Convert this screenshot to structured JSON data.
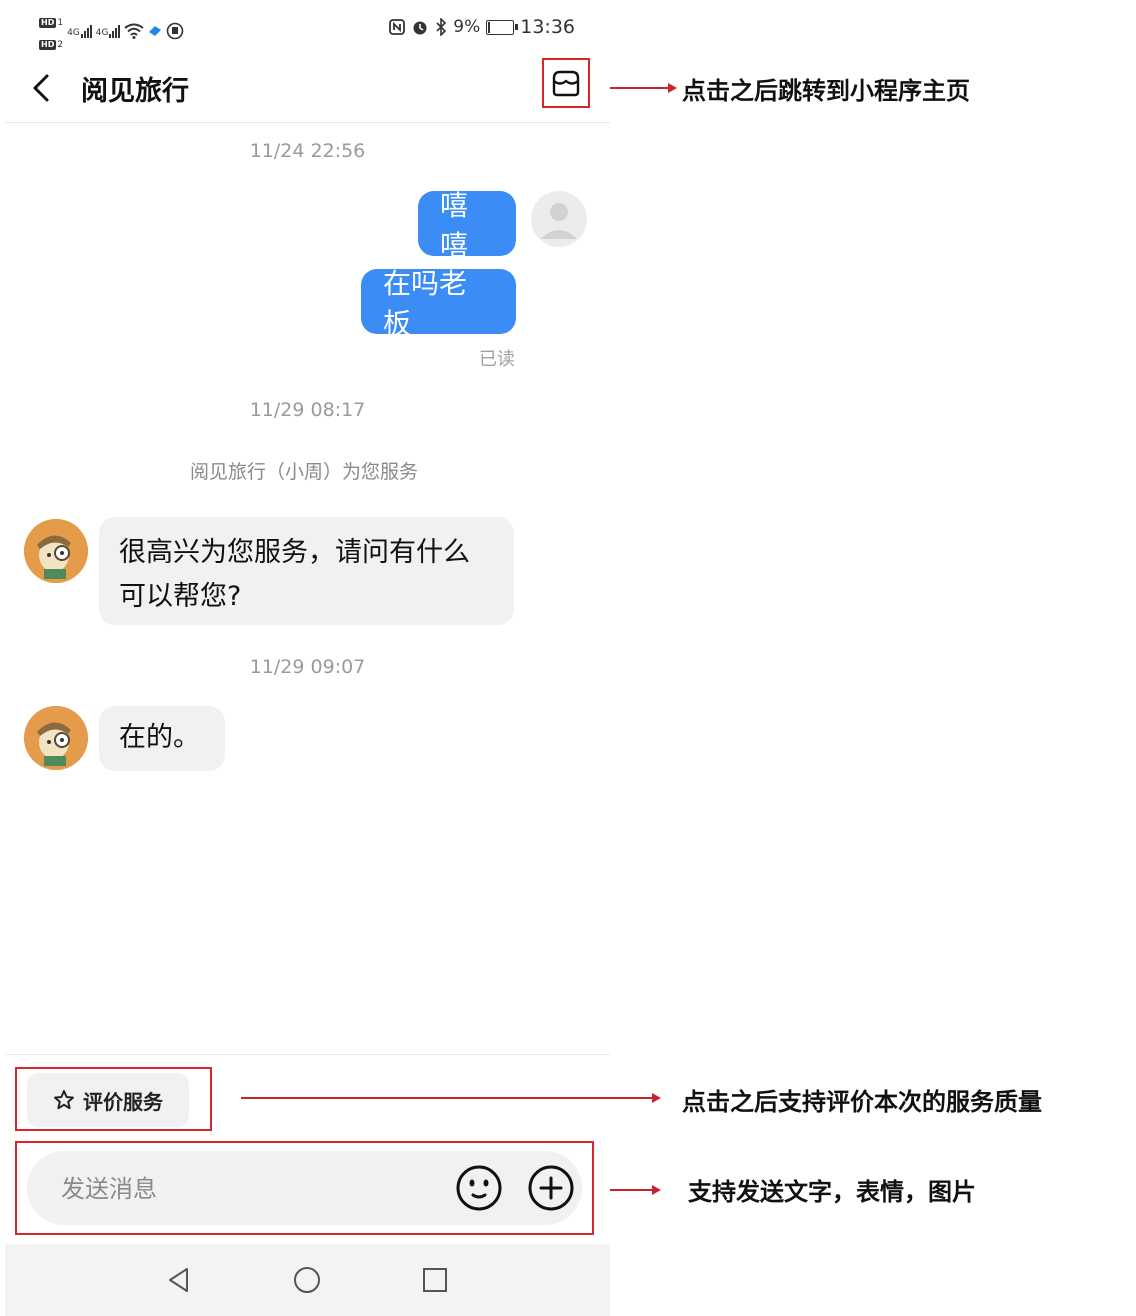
{
  "status_bar": {
    "hd1": "HD",
    "hd1_num": "1",
    "hd2": "HD",
    "hd2_num": "2",
    "net1": "4G",
    "net2": "4G",
    "battery": "9%",
    "battery_level": 0.09,
    "time": "13:36"
  },
  "header": {
    "title": "阅见旅行",
    "back_icon": "chevron-left-icon",
    "store_icon": "store-icon"
  },
  "chat": {
    "ts1": "11/24 22:56",
    "msg_out_1": "嘻嘻",
    "msg_out_2": "在吗老板",
    "read_status": "已读",
    "ts2": "11/29 08:17",
    "system_msg": "阅见旅行（小周）为您服务",
    "msg_in_1": "很高兴为您服务，请问有什么可以帮您?",
    "ts3": "11/29 09:07",
    "msg_in_2": "在的。"
  },
  "bottom": {
    "rate_label": "评价服务",
    "input_placeholder": "发送消息",
    "emoji_icon": "emoji-icon",
    "plus_icon": "plus-circle-icon"
  },
  "annotations": {
    "store": "点击之后跳转到小程序主页",
    "rate": "点击之后支持评价本次的服务质量",
    "input": "支持发送文字，表情，图片"
  },
  "colors": {
    "accent": "#3b8cf5",
    "highlight": "#d8262d",
    "bubble_in": "#f1f1f3"
  }
}
